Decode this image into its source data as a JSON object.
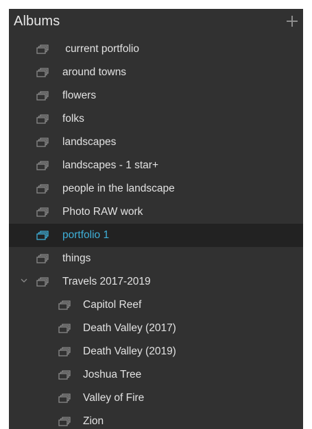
{
  "albums": {
    "title": "Albums",
    "add_icon": "plus-icon",
    "items": [
      {
        "label": " current portfolio",
        "level": 0,
        "selected": false
      },
      {
        "label": "around towns",
        "level": 0,
        "selected": false
      },
      {
        "label": "flowers",
        "level": 0,
        "selected": false
      },
      {
        "label": "folks",
        "level": 0,
        "selected": false
      },
      {
        "label": "landscapes",
        "level": 0,
        "selected": false
      },
      {
        "label": "landscapes - 1 star+",
        "level": 0,
        "selected": false
      },
      {
        "label": "people in the landscape",
        "level": 0,
        "selected": false
      },
      {
        "label": "Photo RAW work",
        "level": 0,
        "selected": false
      },
      {
        "label": "portfolio 1",
        "level": 0,
        "selected": true
      },
      {
        "label": "things",
        "level": 0,
        "selected": false
      },
      {
        "label": "Travels 2017-2019",
        "level": 0,
        "selected": false,
        "expanded": true
      },
      {
        "label": "Capitol Reef",
        "level": 1,
        "selected": false
      },
      {
        "label": "Death Valley (2017)",
        "level": 1,
        "selected": false
      },
      {
        "label": "Death Valley (2019)",
        "level": 1,
        "selected": false
      },
      {
        "label": "Joshua Tree",
        "level": 1,
        "selected": false
      },
      {
        "label": "Valley of Fire",
        "level": 1,
        "selected": false
      },
      {
        "label": "Zion",
        "level": 1,
        "selected": false
      }
    ]
  },
  "colors": {
    "panel_bg": "#313131",
    "selected_bg": "#222222",
    "accent": "#3fb0d9",
    "text": "#e2e2e2",
    "icon": "#8a8a8a"
  }
}
